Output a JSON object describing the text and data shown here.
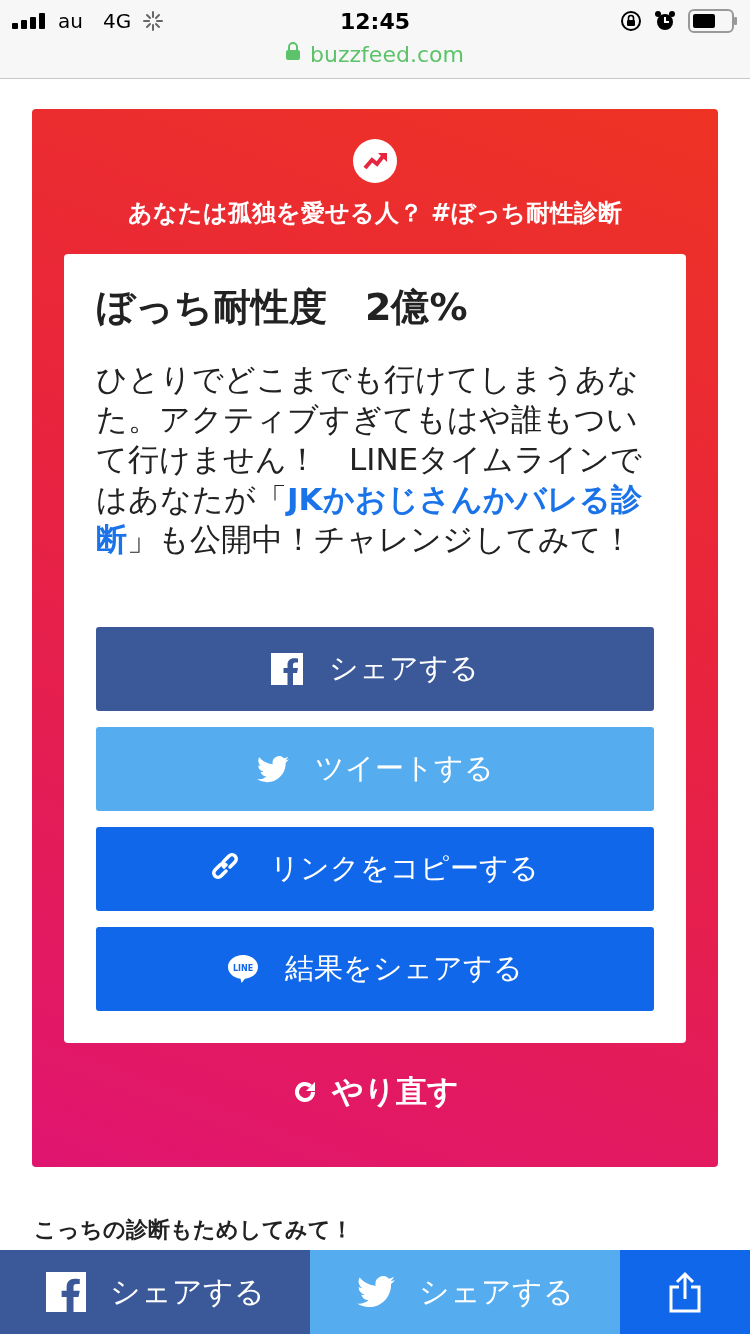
{
  "status_bar": {
    "carrier": "au",
    "network": "4G",
    "time": "12:45"
  },
  "address_bar": {
    "url": "buzzfeed.com"
  },
  "quiz_card": {
    "title": "あなたは孤独を愛せる人？ #ぼっち耐性診断",
    "result": {
      "heading": "ぼっち耐性度　2億%",
      "text": "ひとりでどこまでも行けてしまうあなた。アクティブすぎてもはや誰もついて行けません！　LINEタイムラインではあなたが「**JKかおじさんかバレる診断**」も公開中！チャレンジしてみて！",
      "buttons": [
        {
          "kind": "facebook",
          "label": "シェアする"
        },
        {
          "kind": "twitter",
          "label": "ツイートする"
        },
        {
          "kind": "link",
          "label": "リンクをコピーする"
        },
        {
          "kind": "line",
          "label": "結果をシェアする",
          "icon_text": "LINE"
        }
      ]
    },
    "retry": "やり直す"
  },
  "next_heading": "こっちの診断もためしてみて！",
  "share_bar": [
    {
      "kind": "facebook",
      "label": "シェアする"
    },
    {
      "kind": "twitter",
      "label": "シェアする"
    },
    {
      "kind": "share"
    }
  ]
}
